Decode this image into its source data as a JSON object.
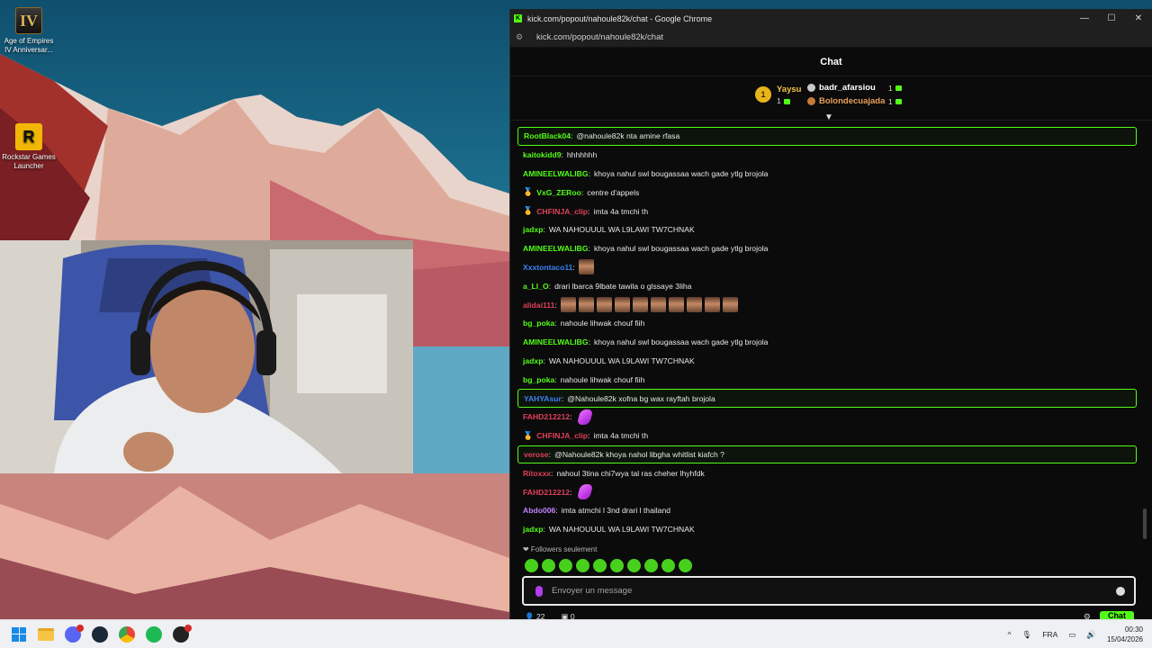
{
  "desktop": {
    "icons": [
      {
        "label": "Age of Empires IV Anniversar...",
        "glyph": "IV",
        "icon": "age-of-empires-icon"
      },
      {
        "label": "Rockstar Games Launcher",
        "glyph": "R",
        "icon": "rockstar-icon"
      }
    ]
  },
  "browser": {
    "window_title": "kick.com/popout/nahoule82k/chat - Google Chrome",
    "url": "kick.com/popout/nahoule82k/chat",
    "logo_glyph": "K"
  },
  "chat": {
    "header": "Chat",
    "leaderboard": {
      "first": {
        "rank": "1",
        "name": "Yaysu",
        "count": "1"
      },
      "others": [
        {
          "name": "badr_afarsiou",
          "count": "1",
          "name_color": "#ffffff",
          "medal_color": "#c9c9c9"
        },
        {
          "name": "Bolondecuajada",
          "count": "1",
          "name_color": "#e9a05a",
          "medal_color": "#c77a3a"
        }
      ]
    },
    "messages": [
      {
        "user": "RootBlack04",
        "color": "#53fc18",
        "text": "@nahoule82k nta amine rfasa",
        "highlight": true
      },
      {
        "user": "kaitokidd9",
        "color": "#53fc18",
        "text": "hhhhhhh"
      },
      {
        "user": "AMINEELWALIBG",
        "color": "#53fc18",
        "text": "khoya nahul swl bougassaa wach gade ytlg brojola"
      },
      {
        "user": "VxG_ZERoo",
        "color": "#53fc18",
        "text": "centre d'appels",
        "badge": "🥇"
      },
      {
        "user": "CHFINJA_clip",
        "color": "#e0405a",
        "text": "imta 4a tmchi th",
        "badge": "🥇"
      },
      {
        "user": "jadxp",
        "color": "#53fc18",
        "text": "WA NAHOUUUL WA L9LAWI TW7CHNAK"
      },
      {
        "user": "AMINEELWALIBG",
        "color": "#53fc18",
        "text": "khoya nahul swl bougassaa wach gade ytlg brojola"
      },
      {
        "user": "Xxxtontaco11",
        "color": "#3b82f6",
        "text": "",
        "emotes": 1
      },
      {
        "user": "a_Ll_O",
        "color": "#53fc18",
        "text": "drari lbarca 9lbate tawila o glssaye 3liha"
      },
      {
        "user": "alidai111",
        "color": "#e0405a",
        "text": "",
        "emotes": 10
      },
      {
        "user": "bg_poka",
        "color": "#53fc18",
        "text": "nahoule lihwak chouf fiih"
      },
      {
        "user": "AMINEELWALIBG",
        "color": "#53fc18",
        "text": "khoya nahul swl bougassaa wach gade ytlg brojola"
      },
      {
        "user": "jadxp",
        "color": "#53fc18",
        "text": "WA NAHOUUUL WA L9LAWI TW7CHNAK"
      },
      {
        "user": "bg_poka",
        "color": "#53fc18",
        "text": "nahoule lihwak chouf fiih"
      },
      {
        "user": "YAHYAsur",
        "color": "#3b82f6",
        "text": "@Nahoule82k xofna bg wax rayftah brojola",
        "highlight": true
      },
      {
        "user": "FAHD212212",
        "color": "#e0405a",
        "text": "",
        "purple": true
      },
      {
        "user": "CHFINJA_clip",
        "color": "#e0405a",
        "text": "imta 4a tmchi th",
        "badge": "🥇"
      },
      {
        "user": "verose",
        "color": "#e0405a",
        "text": "@Nahoule82k khoya nahol libgha whitlist kiafch ?",
        "highlight": true
      },
      {
        "user": "Ritoxxx",
        "color": "#e0405a",
        "text": "nahoul 3tina chi7wya tal ras cheher lhyhfdk"
      },
      {
        "user": "FAHD212212",
        "color": "#e0405a",
        "text": "",
        "purple": true
      },
      {
        "user": "Abdo006",
        "color": "#c084fc",
        "text": "imta atmchi l 3nd drari l thailand"
      },
      {
        "user": "jadxp",
        "color": "#53fc18",
        "text": "WA NAHOUUUL WA L9LAWI TW7CHNAK"
      }
    ],
    "followers_only": "❤ Followers seulement",
    "input_placeholder": "Envoyer un message",
    "viewers": "22",
    "pinned": "0",
    "send_label": "Chat"
  },
  "taskbar": {
    "language": "FRA",
    "time": "00:30",
    "date": "15/04/2026"
  }
}
